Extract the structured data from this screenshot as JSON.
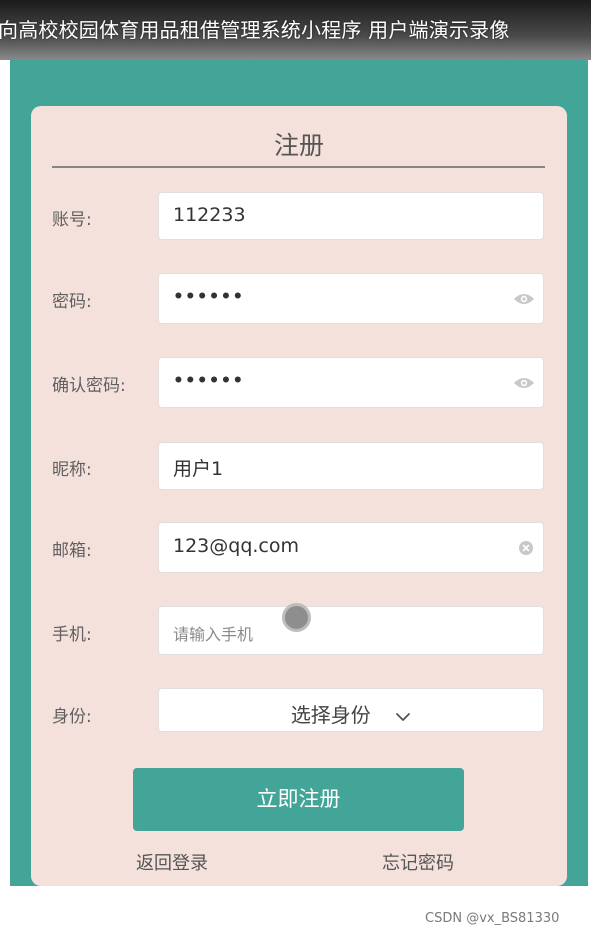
{
  "banner": {
    "title": "向高校校园体育用品租借管理系统小程序 用户端演示录像"
  },
  "form": {
    "title": "注册",
    "account": {
      "label": "账号:",
      "value": "112233"
    },
    "password": {
      "label": "密码:",
      "value": "••••••"
    },
    "confirm_password": {
      "label": "确认密码:",
      "value": "••••••"
    },
    "nickname": {
      "label": "昵称:",
      "value": "用户1"
    },
    "email": {
      "label": "邮箱:",
      "value": "123@qq.com"
    },
    "phone": {
      "label": "手机:",
      "placeholder": "请输入手机"
    },
    "identity": {
      "label": "身份:",
      "selected": "选择身份"
    },
    "submit_label": "立即注册",
    "back_to_login": "返回登录",
    "forgot_password": "忘记密码"
  },
  "watermark": "CSDN @vx_BS81330",
  "colors": {
    "accent": "#42a597",
    "card_bg": "#f5e1dc"
  },
  "icons": {
    "password_toggle": "eye-icon",
    "email_clear": "clear-icon",
    "identity_dropdown": "chevron-down-icon"
  }
}
